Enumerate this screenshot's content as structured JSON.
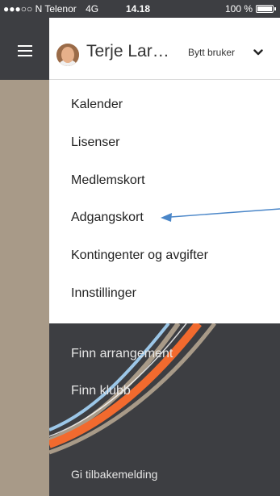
{
  "status_bar": {
    "carrier": "N Telenor",
    "signal": "●●●○○",
    "network": "4G",
    "time": "14.18",
    "battery": "100 %"
  },
  "header": {
    "user_name": "Terje Lar…",
    "switch_user_label": "Bytt bruker",
    "chevron_icon": "chevron-down-icon",
    "avatar_icon": "user-photo"
  },
  "menu": {
    "items": [
      {
        "label": "Kalender"
      },
      {
        "label": "Lisenser"
      },
      {
        "label": "Medlemskort"
      },
      {
        "label": "Adgangskort"
      },
      {
        "label": "Kontingenter og avgifter"
      },
      {
        "label": "Innstillinger"
      }
    ]
  },
  "bottom_menu": {
    "items": [
      {
        "label": "Finn arrangement"
      },
      {
        "label": "Finn klubb"
      }
    ],
    "feedback_label": "Gi tilbakemelding"
  },
  "colors": {
    "dark_bg": "#3d3e42",
    "rail_bg": "#a89a88",
    "arrow": "#4a86c8",
    "swoosh_orange": "#f26a2e",
    "swoosh_blue": "#9cc7e8",
    "swoosh_beige": "#a89a88"
  }
}
